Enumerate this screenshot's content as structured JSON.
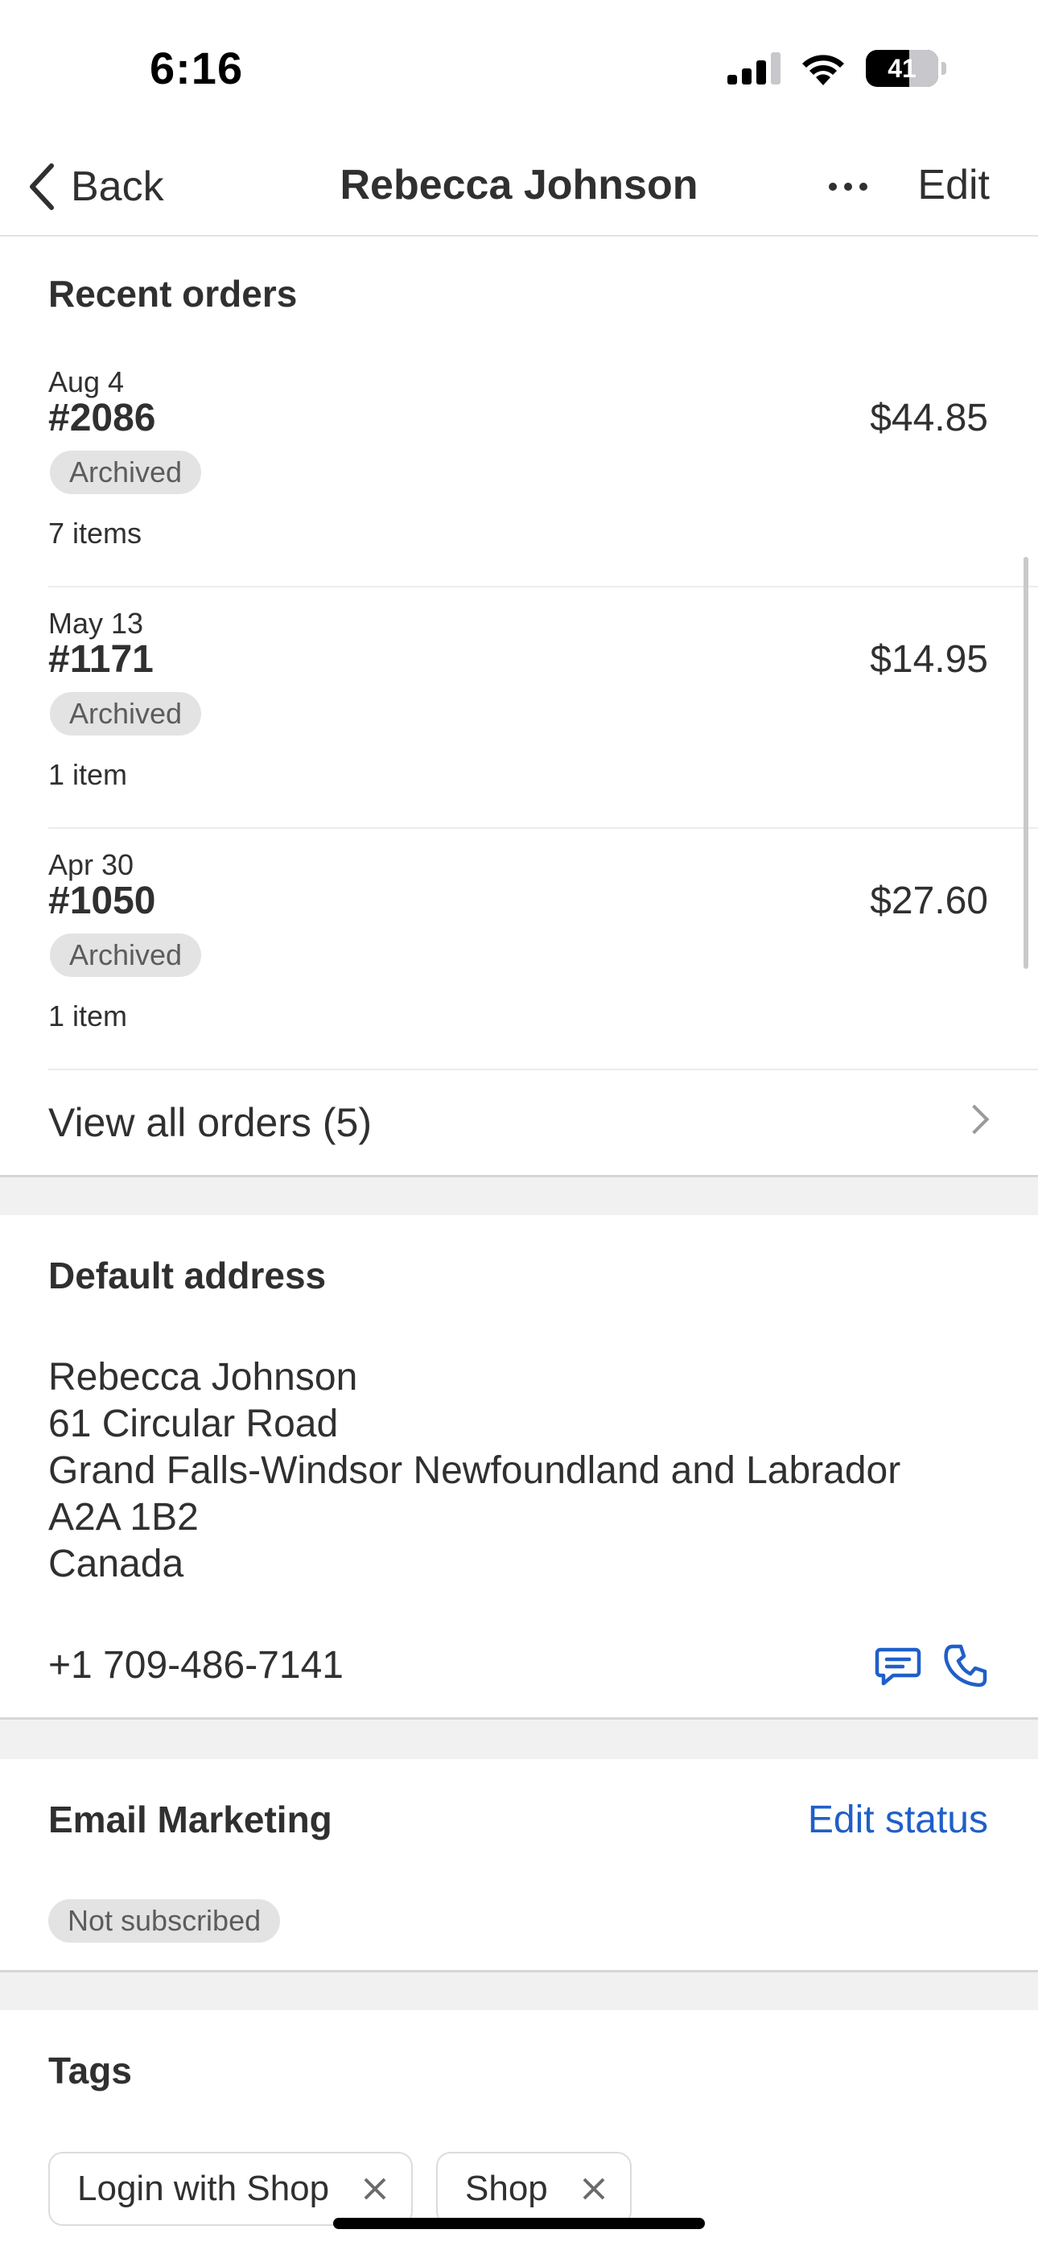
{
  "status_bar": {
    "time": "6:16",
    "battery": "41"
  },
  "nav": {
    "back_label": "Back",
    "title": "Rebecca Johnson",
    "edit_label": "Edit"
  },
  "recent_orders": {
    "title": "Recent orders",
    "orders": [
      {
        "date": "Aug 4",
        "number": "#2086",
        "status": "Archived",
        "items": "7 items",
        "total": "$44.85"
      },
      {
        "date": "May 13",
        "number": "#1171",
        "status": "Archived",
        "items": "1 item",
        "total": "$14.95"
      },
      {
        "date": "Apr 30",
        "number": "#1050",
        "status": "Archived",
        "items": "1 item",
        "total": "$27.60"
      }
    ],
    "view_all_label": "View all orders (5)"
  },
  "default_address": {
    "title": "Default address",
    "lines": [
      "Rebecca Johnson",
      "61 Circular Road",
      "Grand Falls-Windsor Newfoundland and Labrador",
      "A2A 1B2",
      "Canada"
    ],
    "phone": "+1 709-486-7141"
  },
  "email_marketing": {
    "title": "Email Marketing",
    "edit_label": "Edit status",
    "status": "Not subscribed"
  },
  "tags": {
    "title": "Tags",
    "items": [
      "Login with Shop",
      "Shop"
    ]
  },
  "colors": {
    "link": "#1f5fc8",
    "text": "#303030",
    "badge_bg": "#e3e3e3",
    "section_gap": "#f1f1f1"
  }
}
